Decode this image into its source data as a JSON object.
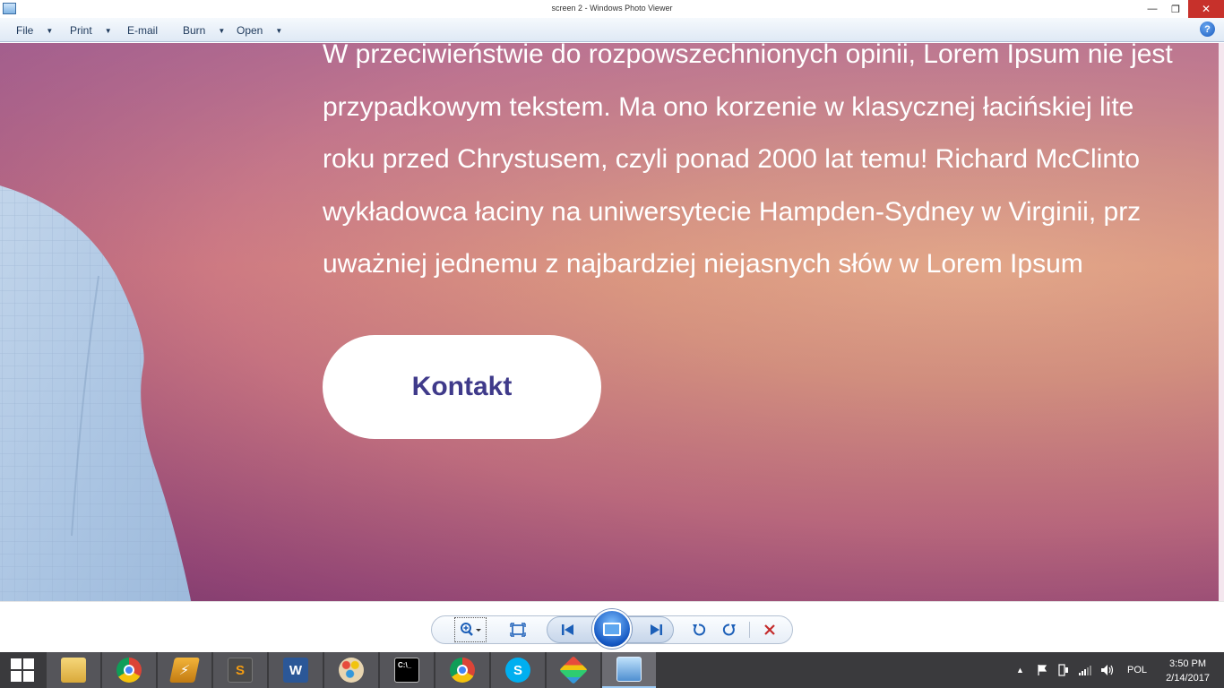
{
  "window": {
    "title": "screen 2 - Windows Photo Viewer",
    "minimize_glyph": "—",
    "maximize_glyph": "❐",
    "close_glyph": "✕"
  },
  "menu": {
    "items": [
      {
        "label": "File",
        "has_dropdown": true
      },
      {
        "label": "Print",
        "has_dropdown": true
      },
      {
        "label": "E-mail",
        "has_dropdown": false
      },
      {
        "label": "Burn",
        "has_dropdown": true
      },
      {
        "label": "Open",
        "has_dropdown": true
      }
    ],
    "help_glyph": "?"
  },
  "image": {
    "paragraph_lines": [
      "W przeciwieństwie do rozpowszechnionych opinii, Lorem Ipsum nie jest",
      "przypadkowym tekstem. Ma ono korzenie w klasycznej łacińskiej lite",
      "roku przed Chrystusem, czyli ponad 2000 lat temu! Richard McClinto",
      "wykładowca łaciny na uniwersytecie Hampden-Sydney w Virginii, prz",
      "uważniej jednemu z najbardziej niejasnych słów w Lorem Ipsum"
    ],
    "button_label": "Kontakt"
  },
  "controls": {
    "icons": [
      "zoom-icon",
      "fit-to-window-icon",
      "previous-icon",
      "slideshow-icon",
      "next-icon",
      "rotate-counterclockwise-icon",
      "rotate-clockwise-icon",
      "delete-icon"
    ]
  },
  "taskbar": {
    "apps": [
      "start",
      "file-explorer",
      "chrome",
      "winamp",
      "sublime-text",
      "word",
      "paint",
      "command-prompt",
      "chrome",
      "skype",
      "git",
      "photo-viewer"
    ],
    "tray": {
      "language": "POL",
      "time": "3:50 PM",
      "date": "2/14/2017"
    }
  },
  "colors": {
    "menu_text": "#1e395b",
    "button_text": "#3f3a8a",
    "taskbar_bg": "#3a3a3d",
    "close_button": "#c7312b",
    "control_blue": "#1c5fb8"
  }
}
